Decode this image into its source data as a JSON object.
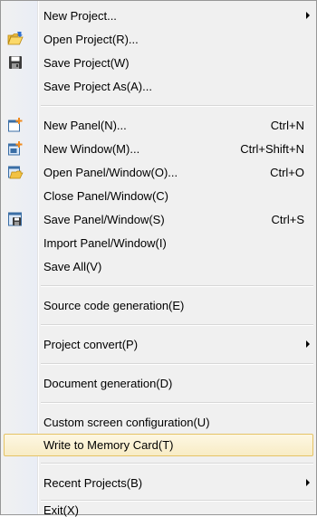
{
  "menu": {
    "items": [
      {
        "label": "New Project...",
        "shortcut": "",
        "submenu": true,
        "icon": ""
      },
      {
        "label": "Open Project(R)...",
        "shortcut": "",
        "submenu": false,
        "icon": "open-folder-icon"
      },
      {
        "label": "Save Project(W)",
        "shortcut": "",
        "submenu": false,
        "icon": "floppy-disk-icon"
      },
      {
        "label": "Save Project As(A)...",
        "shortcut": "",
        "submenu": false,
        "icon": ""
      },
      {
        "label": "New Panel(N)...",
        "shortcut": "Ctrl+N",
        "submenu": false,
        "icon": "new-panel-icon"
      },
      {
        "label": "New Window(M)...",
        "shortcut": "Ctrl+Shift+N",
        "submenu": false,
        "icon": "new-window-icon"
      },
      {
        "label": "Open Panel/Window(O)...",
        "shortcut": "Ctrl+O",
        "submenu": false,
        "icon": "open-panel-icon"
      },
      {
        "label": "Close Panel/Window(C)",
        "shortcut": "",
        "submenu": false,
        "icon": ""
      },
      {
        "label": "Save Panel/Window(S)",
        "shortcut": "Ctrl+S",
        "submenu": false,
        "icon": "save-panel-icon"
      },
      {
        "label": "Import Panel/Window(I)",
        "shortcut": "",
        "submenu": false,
        "icon": ""
      },
      {
        "label": "Save All(V)",
        "shortcut": "",
        "submenu": false,
        "icon": ""
      },
      {
        "label": "Source code generation(E)",
        "shortcut": "",
        "submenu": false,
        "icon": ""
      },
      {
        "label": "Project convert(P)",
        "shortcut": "",
        "submenu": true,
        "icon": ""
      },
      {
        "label": "Document generation(D)",
        "shortcut": "",
        "submenu": false,
        "icon": ""
      },
      {
        "label": "Custom screen configuration(U)",
        "shortcut": "",
        "submenu": false,
        "icon": ""
      },
      {
        "label": "Write to Memory Card(T)",
        "shortcut": "",
        "submenu": false,
        "icon": "",
        "highlighted": true
      },
      {
        "label": "Recent Projects(B)",
        "shortcut": "",
        "submenu": true,
        "icon": ""
      },
      {
        "label": "Exit(X)",
        "shortcut": "",
        "submenu": false,
        "icon": ""
      }
    ],
    "colors": {
      "highlight_border": "#e5c365",
      "highlight_fill": "#f8ecc5",
      "background": "#f0f0f0"
    }
  }
}
